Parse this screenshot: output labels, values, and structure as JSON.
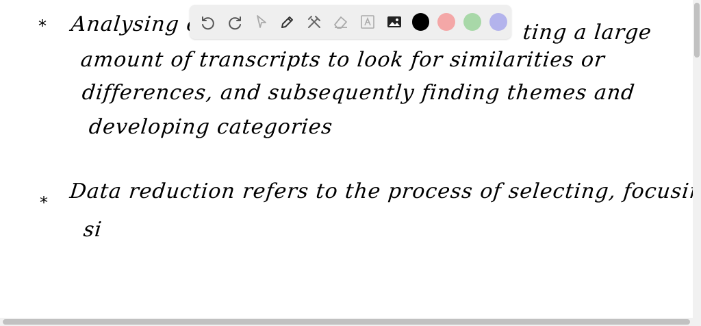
{
  "notes": {
    "bullet_symbol": "*",
    "lines": [
      "Analysing of",
      "ting a large",
      "amount of  transcripts  to look  for  similarities or",
      "differences, and  subsequently  finding  themes and",
      "developing  categories",
      "Data  reduction  refers  to the  process  of  selecting, focusing,",
      "si"
    ]
  },
  "toolbar": {
    "tools": [
      "undo-icon",
      "redo-icon",
      "select-icon",
      "pen-icon",
      "tools-icon",
      "eraser-icon",
      "text-icon",
      "image-icon"
    ],
    "colors": [
      "#000000",
      "#f4a7a7",
      "#a8d8a8",
      "#b3b3ec"
    ]
  }
}
